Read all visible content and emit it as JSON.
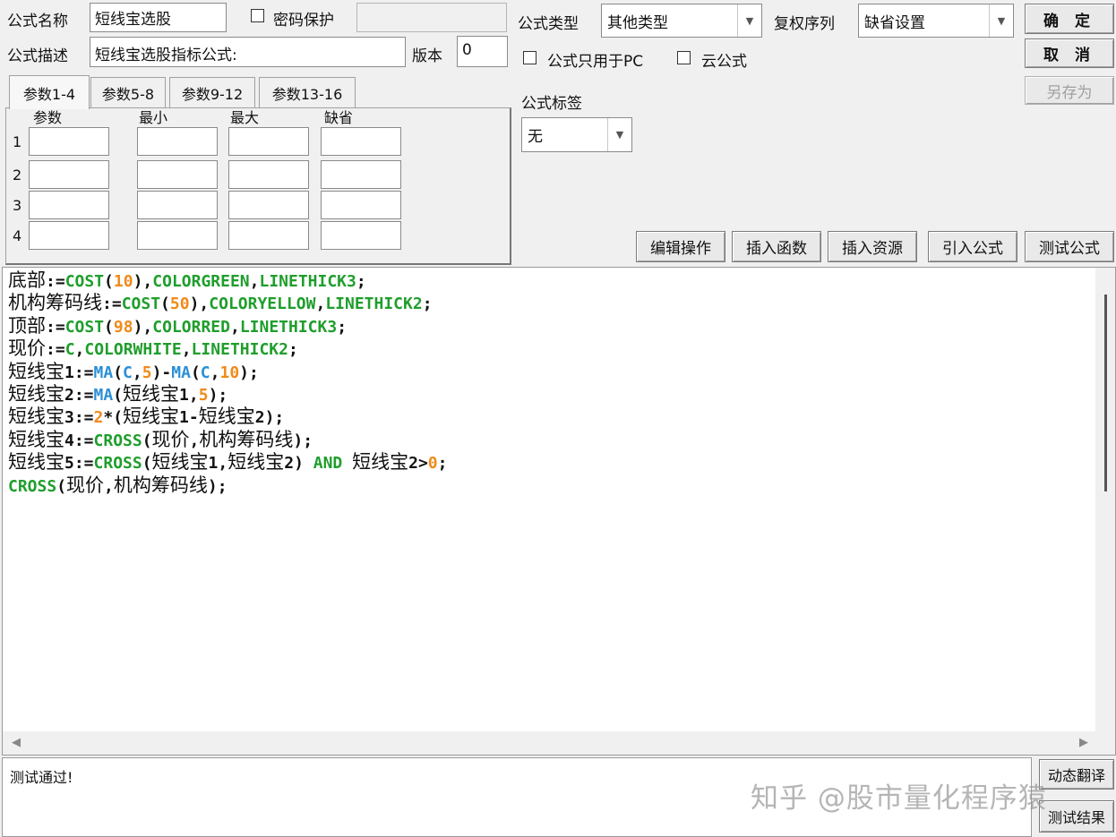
{
  "top": {
    "name_label": "公式名称",
    "name_value": "短线宝选股",
    "password_label": "密码保护",
    "desc_label": "公式描述",
    "desc_value": "短线宝选股指标公式:",
    "version_label": "版本",
    "version_value": "0",
    "type_label": "公式类型",
    "type_value": "其他类型",
    "restore_label": "复权序列",
    "restore_value": "缺省设置",
    "pc_only_label": "公式只用于PC",
    "cloud_label": "云公式",
    "tag_label": "公式标签",
    "tag_value": "无"
  },
  "buttons": {
    "ok": "确 定",
    "cancel": "取 消",
    "save_as": "另存为",
    "edit_ops": "编辑操作",
    "insert_func": "插入函数",
    "insert_res": "插入资源",
    "import_formula": "引入公式",
    "test_formula": "测试公式",
    "dyn_translate": "动态翻译",
    "test_result": "测试结果"
  },
  "params": {
    "tabs": [
      "参数1-4",
      "参数5-8",
      "参数9-12",
      "参数13-16"
    ],
    "headers": [
      "参数",
      "最小",
      "最大",
      "缺省"
    ],
    "rows": [
      "1",
      "2",
      "3",
      "4"
    ]
  },
  "colors": {
    "kw_green": "#1f9e2c",
    "func_blue": "#2b8fd6",
    "num_orange": "#f08a1a",
    "text": "#111111"
  },
  "code_lines": [
    [
      {
        "t": "底部",
        "c": "cn"
      },
      {
        "t": ":=",
        "c": "p"
      },
      {
        "t": "COST",
        "c": "g"
      },
      {
        "t": "(",
        "c": "p"
      },
      {
        "t": "10",
        "c": "o"
      },
      {
        "t": "),",
        "c": "p"
      },
      {
        "t": "COLORGREEN",
        "c": "g"
      },
      {
        "t": ",",
        "c": "p"
      },
      {
        "t": "LINETHICK3",
        "c": "g"
      },
      {
        "t": ";",
        "c": "p"
      }
    ],
    [
      {
        "t": "机构筹码线",
        "c": "cn"
      },
      {
        "t": ":=",
        "c": "p"
      },
      {
        "t": "COST",
        "c": "g"
      },
      {
        "t": "(",
        "c": "p"
      },
      {
        "t": "50",
        "c": "o"
      },
      {
        "t": "),",
        "c": "p"
      },
      {
        "t": "COLORYELLOW",
        "c": "g"
      },
      {
        "t": ",",
        "c": "p"
      },
      {
        "t": "LINETHICK2",
        "c": "g"
      },
      {
        "t": ";",
        "c": "p"
      }
    ],
    [
      {
        "t": "顶部",
        "c": "cn"
      },
      {
        "t": ":=",
        "c": "p"
      },
      {
        "t": "COST",
        "c": "g"
      },
      {
        "t": "(",
        "c": "p"
      },
      {
        "t": "98",
        "c": "o"
      },
      {
        "t": "),",
        "c": "p"
      },
      {
        "t": "COLORRED",
        "c": "g"
      },
      {
        "t": ",",
        "c": "p"
      },
      {
        "t": "LINETHICK3",
        "c": "g"
      },
      {
        "t": ";",
        "c": "p"
      }
    ],
    [
      {
        "t": "现价",
        "c": "cn"
      },
      {
        "t": ":=",
        "c": "p"
      },
      {
        "t": "C",
        "c": "g"
      },
      {
        "t": ",",
        "c": "p"
      },
      {
        "t": "COLORWHITE",
        "c": "g"
      },
      {
        "t": ",",
        "c": "p"
      },
      {
        "t": "LINETHICK2",
        "c": "g"
      },
      {
        "t": ";",
        "c": "p"
      }
    ],
    [
      {
        "t": "短线宝",
        "c": "cn"
      },
      {
        "t": "1:=",
        "c": "p"
      },
      {
        "t": "MA",
        "c": "b"
      },
      {
        "t": "(",
        "c": "p"
      },
      {
        "t": "C",
        "c": "b"
      },
      {
        "t": ",",
        "c": "p"
      },
      {
        "t": "5",
        "c": "o"
      },
      {
        "t": ")-",
        "c": "p"
      },
      {
        "t": "MA",
        "c": "b"
      },
      {
        "t": "(",
        "c": "p"
      },
      {
        "t": "C",
        "c": "b"
      },
      {
        "t": ",",
        "c": "p"
      },
      {
        "t": "10",
        "c": "o"
      },
      {
        "t": ");",
        "c": "p"
      }
    ],
    [
      {
        "t": "短线宝",
        "c": "cn"
      },
      {
        "t": "2:=",
        "c": "p"
      },
      {
        "t": "MA",
        "c": "b"
      },
      {
        "t": "(",
        "c": "p"
      },
      {
        "t": "短线宝",
        "c": "cn"
      },
      {
        "t": "1,",
        "c": "p"
      },
      {
        "t": "5",
        "c": "o"
      },
      {
        "t": ");",
        "c": "p"
      }
    ],
    [
      {
        "t": "短线宝",
        "c": "cn"
      },
      {
        "t": "3:=",
        "c": "p"
      },
      {
        "t": "2",
        "c": "o"
      },
      {
        "t": "*(",
        "c": "p"
      },
      {
        "t": "短线宝",
        "c": "cn"
      },
      {
        "t": "1-",
        "c": "p"
      },
      {
        "t": "短线宝",
        "c": "cn"
      },
      {
        "t": "2);",
        "c": "p"
      }
    ],
    [
      {
        "t": "短线宝",
        "c": "cn"
      },
      {
        "t": "4:=",
        "c": "p"
      },
      {
        "t": "CROSS",
        "c": "g"
      },
      {
        "t": "(",
        "c": "p"
      },
      {
        "t": "现价",
        "c": "cn"
      },
      {
        "t": ",",
        "c": "p"
      },
      {
        "t": "机构筹码线",
        "c": "cn"
      },
      {
        "t": ");",
        "c": "p"
      }
    ],
    [
      {
        "t": "短线宝",
        "c": "cn"
      },
      {
        "t": "5:=",
        "c": "p"
      },
      {
        "t": "CROSS",
        "c": "g"
      },
      {
        "t": "(",
        "c": "p"
      },
      {
        "t": "短线宝",
        "c": "cn"
      },
      {
        "t": "1,",
        "c": "p"
      },
      {
        "t": "短线宝",
        "c": "cn"
      },
      {
        "t": "2) ",
        "c": "p"
      },
      {
        "t": "AND",
        "c": "g"
      },
      {
        "t": " ",
        "c": "p"
      },
      {
        "t": "短线宝",
        "c": "cn"
      },
      {
        "t": "2>",
        "c": "p"
      },
      {
        "t": "0",
        "c": "o"
      },
      {
        "t": ";",
        "c": "p"
      }
    ],
    [
      {
        "t": "CROSS",
        "c": "g"
      },
      {
        "t": "(",
        "c": "p"
      },
      {
        "t": "现价",
        "c": "cn"
      },
      {
        "t": ",",
        "c": "p"
      },
      {
        "t": "机构筹码线",
        "c": "cn"
      },
      {
        "t": ");",
        "c": "p"
      }
    ]
  ],
  "output": {
    "text": "测试通过!"
  },
  "watermark": "知乎 @股市量化程序猿"
}
